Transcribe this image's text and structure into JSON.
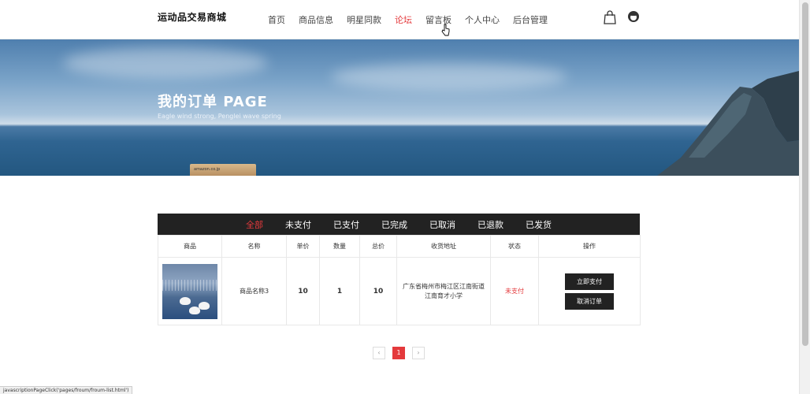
{
  "header": {
    "logo": "运动品交易商城",
    "nav": [
      {
        "label": "首页",
        "active": false
      },
      {
        "label": "商品信息",
        "active": false
      },
      {
        "label": "明星同款",
        "active": false
      },
      {
        "label": "论坛",
        "active": true
      },
      {
        "label": "留言板",
        "active": false
      },
      {
        "label": "个人中心",
        "active": false
      },
      {
        "label": "后台管理",
        "active": false
      }
    ],
    "icons": [
      "shopping-bag-icon",
      "user-avatar-icon"
    ]
  },
  "banner": {
    "title": "我的订单 PAGE",
    "subtitle": "Eagle wind strong, Penglei wave spring",
    "box_label": "amazon.co.jp"
  },
  "tabs": [
    {
      "label": "全部",
      "active": true
    },
    {
      "label": "未支付",
      "active": false
    },
    {
      "label": "已支付",
      "active": false
    },
    {
      "label": "已完成",
      "active": false
    },
    {
      "label": "已取消",
      "active": false
    },
    {
      "label": "已退款",
      "active": false
    },
    {
      "label": "已发货",
      "active": false
    }
  ],
  "table": {
    "headers": [
      "商品",
      "名称",
      "单价",
      "数量",
      "总价",
      "收货地址",
      "状态",
      "操作"
    ],
    "rows": [
      {
        "name": "商品名称3",
        "price": "10",
        "qty": "1",
        "total": "10",
        "address": "广东省梅州市梅江区江南街道江南育才小学",
        "status": "未支付",
        "actions": [
          "立即支付",
          "取消订单"
        ]
      }
    ]
  },
  "pager": {
    "prev": "‹",
    "current": "1",
    "next": "›"
  },
  "statusbar": "javascriptionPageClick('pages/froum/froum-list.html')",
  "colors": {
    "accent": "#e4393c",
    "dark": "#222222"
  }
}
